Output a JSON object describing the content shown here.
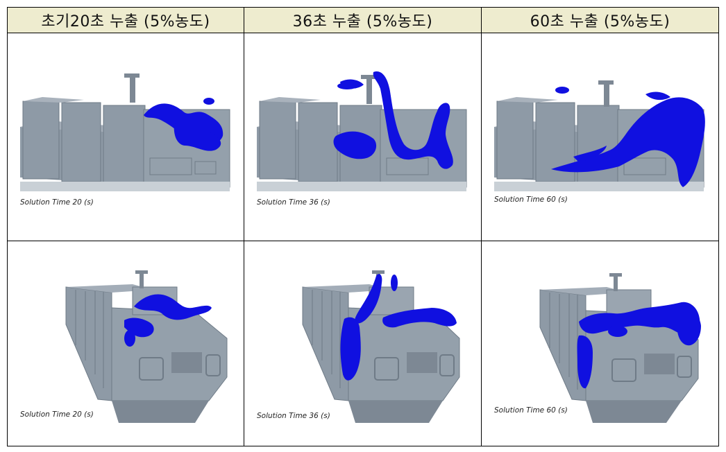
{
  "headers": [
    "초기20초 누출 (5%농도)",
    "36초 누출 (5%농도)",
    "60초 누출 (5%농도)"
  ],
  "rows": [
    {
      "view": "side",
      "cells": [
        {
          "caption": "Solution Time 20 (s)"
        },
        {
          "caption": "Solution Time 36 (s)"
        },
        {
          "caption": "Solution Time 60 (s)"
        }
      ]
    },
    {
      "view": "stern",
      "cells": [
        {
          "caption": "Solution Time 20 (s)"
        },
        {
          "caption": "Solution Time 36 (s)"
        },
        {
          "caption": "Solution Time 60 (s)"
        }
      ]
    }
  ],
  "colors": {
    "header_bg": "#eeeccf",
    "ship_gray": "#8e9aa6",
    "ship_dark": "#6f7b87",
    "plume_blue": "#1010e0"
  }
}
